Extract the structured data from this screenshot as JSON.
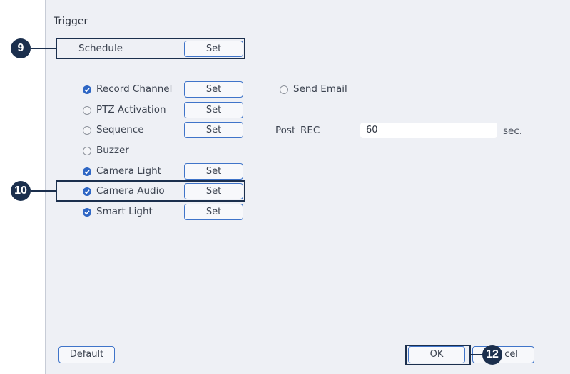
{
  "title": "Trigger",
  "schedule": {
    "label": "Schedule",
    "button": "Set"
  },
  "options": [
    {
      "label": "Record Channel",
      "checked": true,
      "button": "Set"
    },
    {
      "label": "PTZ Activation",
      "checked": false,
      "button": "Set"
    },
    {
      "label": "Sequence",
      "checked": false,
      "button": "Set"
    },
    {
      "label": "Buzzer",
      "checked": false
    },
    {
      "label": "Camera Light",
      "checked": true,
      "button": "Set"
    },
    {
      "label": "Camera Audio",
      "checked": true,
      "button": "Set"
    },
    {
      "label": "Smart Light",
      "checked": true,
      "button": "Set"
    }
  ],
  "send_email": {
    "label": "Send Email",
    "checked": false
  },
  "post_rec": {
    "label": "Post_REC",
    "value": "60",
    "unit": "sec."
  },
  "footer": {
    "default_label": "Default",
    "ok_label": "OK",
    "cancel_label": "cel"
  },
  "callouts": {
    "schedule": "9",
    "camera_audio": "10",
    "ok": "12"
  },
  "colors": {
    "accent": "#2e66c4",
    "panel_bg": "#eef0f5",
    "callout": "#1b2f4d"
  }
}
